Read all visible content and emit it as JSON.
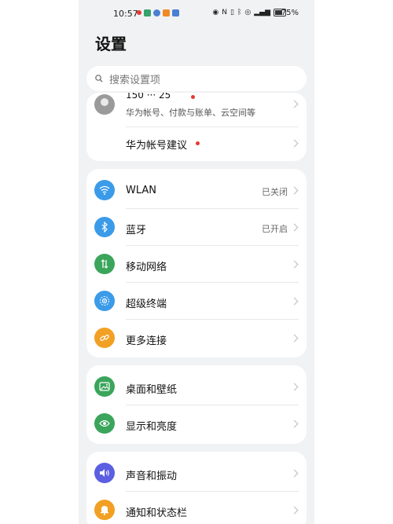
{
  "status_bar": {
    "time": "10:57",
    "battery": "75%",
    "notification_icons": [
      "#e53935",
      "#37a36b",
      "#4a7fd1",
      "#f08a24",
      "#4a7fd1"
    ]
  },
  "header": {
    "title": "设置"
  },
  "search": {
    "placeholder": "搜索设置项"
  },
  "account": {
    "name_partial": "150 ··· 25",
    "subtitle": "华为帐号、付款与账单、云空间等",
    "suggestion_label": "华为帐号建议"
  },
  "connectivity": {
    "items": [
      {
        "label": "WLAN",
        "value": "已关闭",
        "icon": "wifi-icon",
        "color": "#3b9be8"
      },
      {
        "label": "蓝牙",
        "value": "已开启",
        "icon": "bluetooth-icon",
        "color": "#3b9be8"
      },
      {
        "label": "移动网络",
        "value": "",
        "icon": "mobile-network-icon",
        "color": "#3aa55b"
      },
      {
        "label": "超级终端",
        "value": "",
        "icon": "super-device-icon",
        "color": "#3b9be8"
      },
      {
        "label": "更多连接",
        "value": "",
        "icon": "link-icon",
        "color": "#f2a024"
      }
    ]
  },
  "display": {
    "items": [
      {
        "label": "桌面和壁纸",
        "icon": "wallpaper-icon",
        "color": "#3aa55b"
      },
      {
        "label": "显示和亮度",
        "icon": "eye-icon",
        "color": "#3aa55b"
      }
    ]
  },
  "sound": {
    "items": [
      {
        "label": "声音和振动",
        "icon": "speaker-icon",
        "color": "#5b5fe0"
      },
      {
        "label": "通知和状态栏",
        "icon": "bell-icon",
        "color": "#f2a024"
      }
    ]
  }
}
